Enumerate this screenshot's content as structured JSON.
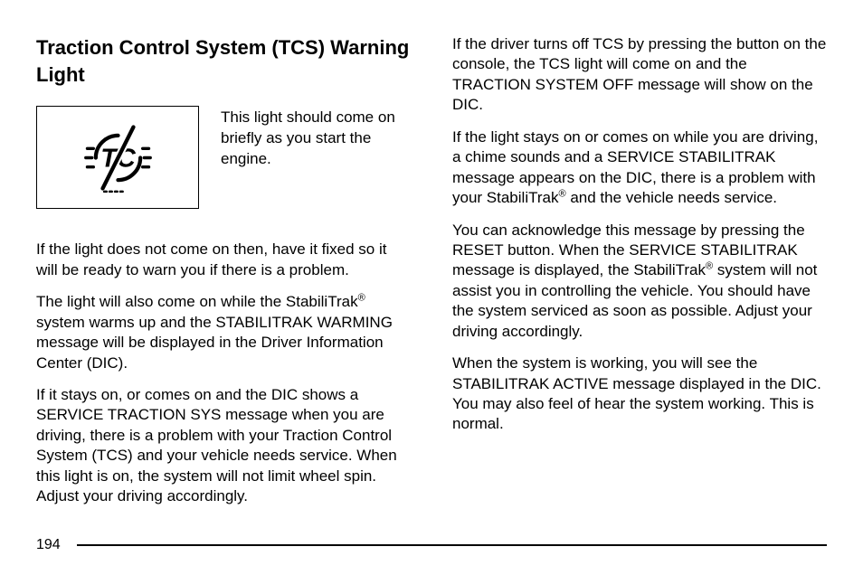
{
  "heading": "Traction Control System (TCS) Warning Light",
  "icon_caption": "This light should come on briefly as you start the engine.",
  "left_paragraphs": [
    "If the light does not come on then, have it fixed so it will be ready to warn you if there is a problem.",
    "The light will also come on while the StabiliTrak® system warms up and the STABILITRAK WARMING message will be displayed in the Driver Information Center (DIC).",
    "If it stays on, or comes on and the DIC shows a SERVICE TRACTION SYS message when you are driving, there is a problem with your Traction Control System (TCS) and your vehicle needs service. When this light is on, the system will not limit wheel spin. Adjust your driving accordingly."
  ],
  "right_paragraphs": [
    "If the driver turns off TCS by pressing the button on the console, the TCS light will come on and the TRACTION SYSTEM OFF message will show on the DIC.",
    "If the light stays on or comes on while you are driving, a chime sounds and a SERVICE STABILITRAK message appears on the DIC, there is a problem with your StabiliTrak® and the vehicle needs service.",
    "You can acknowledge this message by pressing the RESET button. When the SERVICE STABILITRAK message is displayed, the StabiliTrak® system will not assist you in controlling the vehicle. You should have the system serviced as soon as possible. Adjust your driving accordingly.",
    "When the system is working, you will see the STABILITRAK ACTIVE message displayed in the DIC. You may also feel of hear the system working. This is normal."
  ],
  "page_number": "194"
}
